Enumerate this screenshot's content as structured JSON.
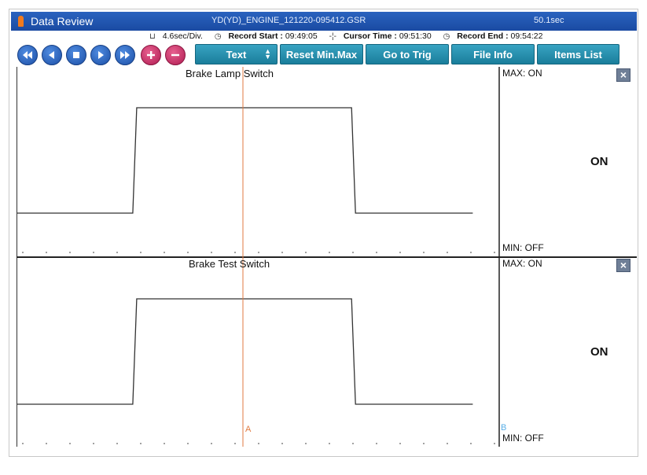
{
  "window": {
    "title": "Data Review",
    "file_name": "YD(YD)_ENGINE_121220-095412.GSR",
    "duration": "50.1sec"
  },
  "info": {
    "time_per_div": "4.6sec/Div.",
    "record_start_label": "Record Start :",
    "record_start": "09:49:05",
    "cursor_time_label": "Cursor Time :",
    "cursor_time": "09:51:30",
    "record_end_label": "Record End :",
    "record_end": "09:54:22"
  },
  "toolbar": {
    "nav_buttons": [
      "rewind-icon",
      "step-back-icon",
      "stop-icon",
      "play-icon",
      "fast-forward-icon"
    ],
    "zoom_buttons": [
      "plus-icon",
      "minus-icon"
    ],
    "text_select": "Text",
    "reset_label": "Reset Min.Max",
    "goto_trig_label": "Go to Trig",
    "file_info_label": "File Info",
    "items_list_label": "Items List"
  },
  "cursors": {
    "a_label": "A",
    "b_label": "B"
  },
  "colors": {
    "accent": "#1a4aa2",
    "cursor": "#e07a40",
    "button_teal": "#1a7e9b",
    "zoom_red": "#b01c52"
  },
  "chart_data": [
    {
      "type": "line",
      "title": "Brake Lamp Switch",
      "max_label": "MAX: ON",
      "min_label": "MIN: OFF",
      "current_value": "ON",
      "levels": [
        "OFF",
        "ON"
      ],
      "x_range_sec": [
        0,
        50.1
      ],
      "points": [
        [
          0,
          "OFF"
        ],
        [
          11.8,
          "OFF"
        ],
        [
          12.2,
          "ON"
        ],
        [
          34.0,
          "ON"
        ],
        [
          34.4,
          "OFF"
        ],
        [
          46.3,
          "OFF"
        ]
      ]
    },
    {
      "type": "line",
      "title": "Brake Test Switch",
      "max_label": "MAX: ON",
      "min_label": "MIN: OFF",
      "current_value": "ON",
      "levels": [
        "OFF",
        "ON"
      ],
      "x_range_sec": [
        0,
        50.1
      ],
      "points": [
        [
          0,
          "OFF"
        ],
        [
          11.8,
          "OFF"
        ],
        [
          12.2,
          "ON"
        ],
        [
          34.0,
          "ON"
        ],
        [
          34.4,
          "OFF"
        ],
        [
          46.3,
          "OFF"
        ]
      ]
    }
  ]
}
